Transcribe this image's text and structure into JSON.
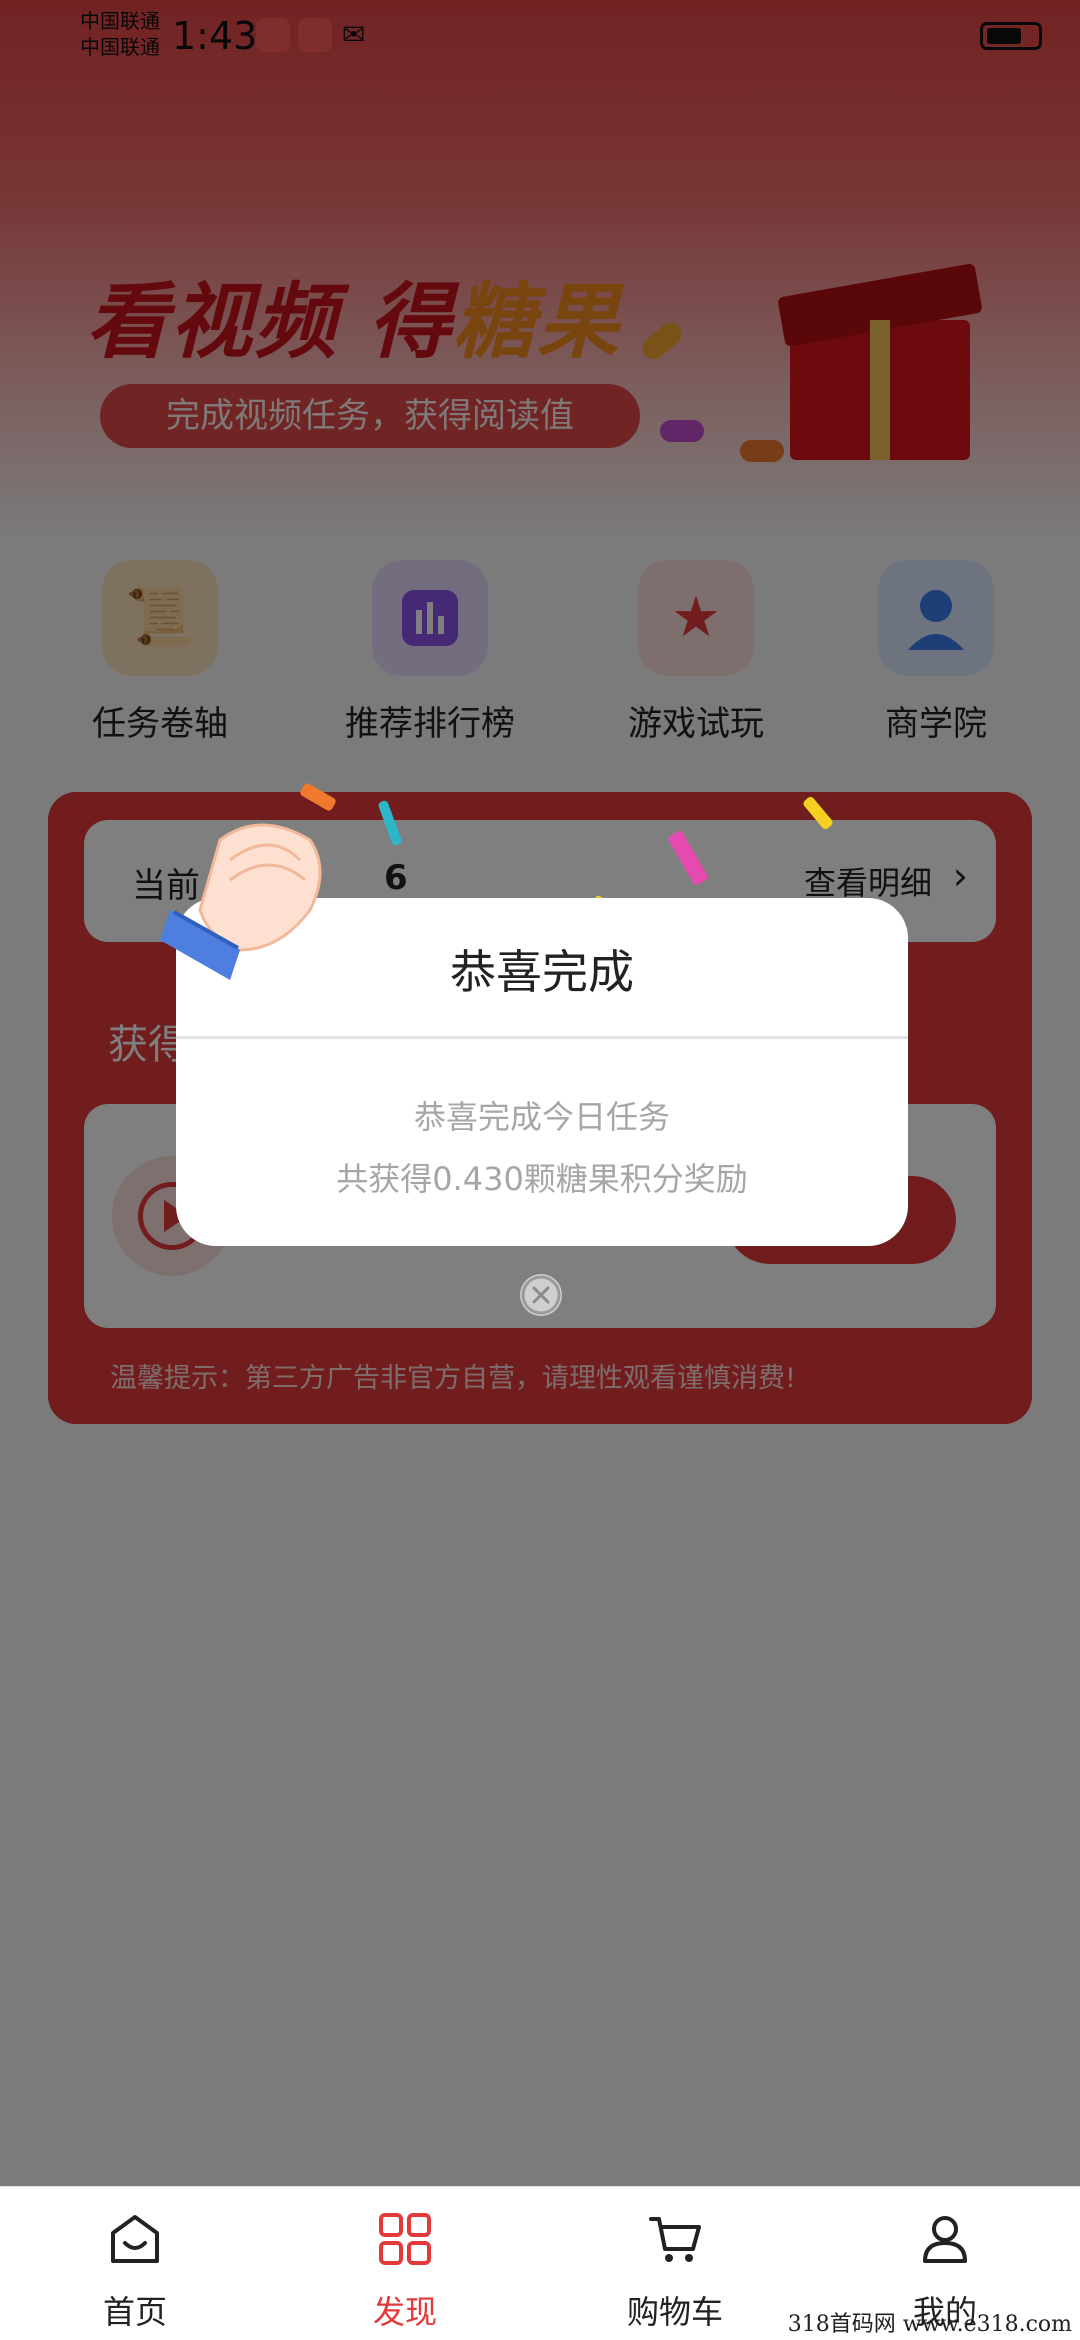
{
  "status_bar": {
    "carrier_1": "中国联通",
    "carrier_2": "中国联通",
    "time": "1:43"
  },
  "banner": {
    "title_part1": "看视频 得",
    "title_part2": "糖果",
    "subtitle": "完成视频任务，获得阅读值"
  },
  "shortcuts": [
    {
      "label": "任务卷轴",
      "icon": "scroll-icon"
    },
    {
      "label": "推荐排行榜",
      "icon": "ranking-chart-icon"
    },
    {
      "label": "游戏试玩",
      "icon": "star-icon"
    },
    {
      "label": "商学院",
      "icon": "person-icon"
    }
  ],
  "task_card": {
    "current_label": "当前",
    "current_value": "6",
    "detail_link": "查看明细",
    "earn_label": "获得",
    "tip": "温馨提示：第三方广告非官方自营，请理性观看谨慎消费!"
  },
  "modal": {
    "title": "恭喜完成",
    "line1": "恭喜完成今日任务",
    "line2": "共获得0.430颗糖果积分奖励"
  },
  "tabbar": {
    "tabs": [
      {
        "label": "首页",
        "icon": "home-icon",
        "active": false
      },
      {
        "label": "发现",
        "icon": "grid-icon",
        "active": true
      },
      {
        "label": "购物车",
        "icon": "cart-icon",
        "active": false
      },
      {
        "label": "我的",
        "icon": "user-icon",
        "active": false
      }
    ]
  },
  "watermark": "318首码网 www.e318.com",
  "colors": {
    "primary_red": "#e23a3a",
    "overlay": "rgba(0,0,0,0.5)"
  }
}
